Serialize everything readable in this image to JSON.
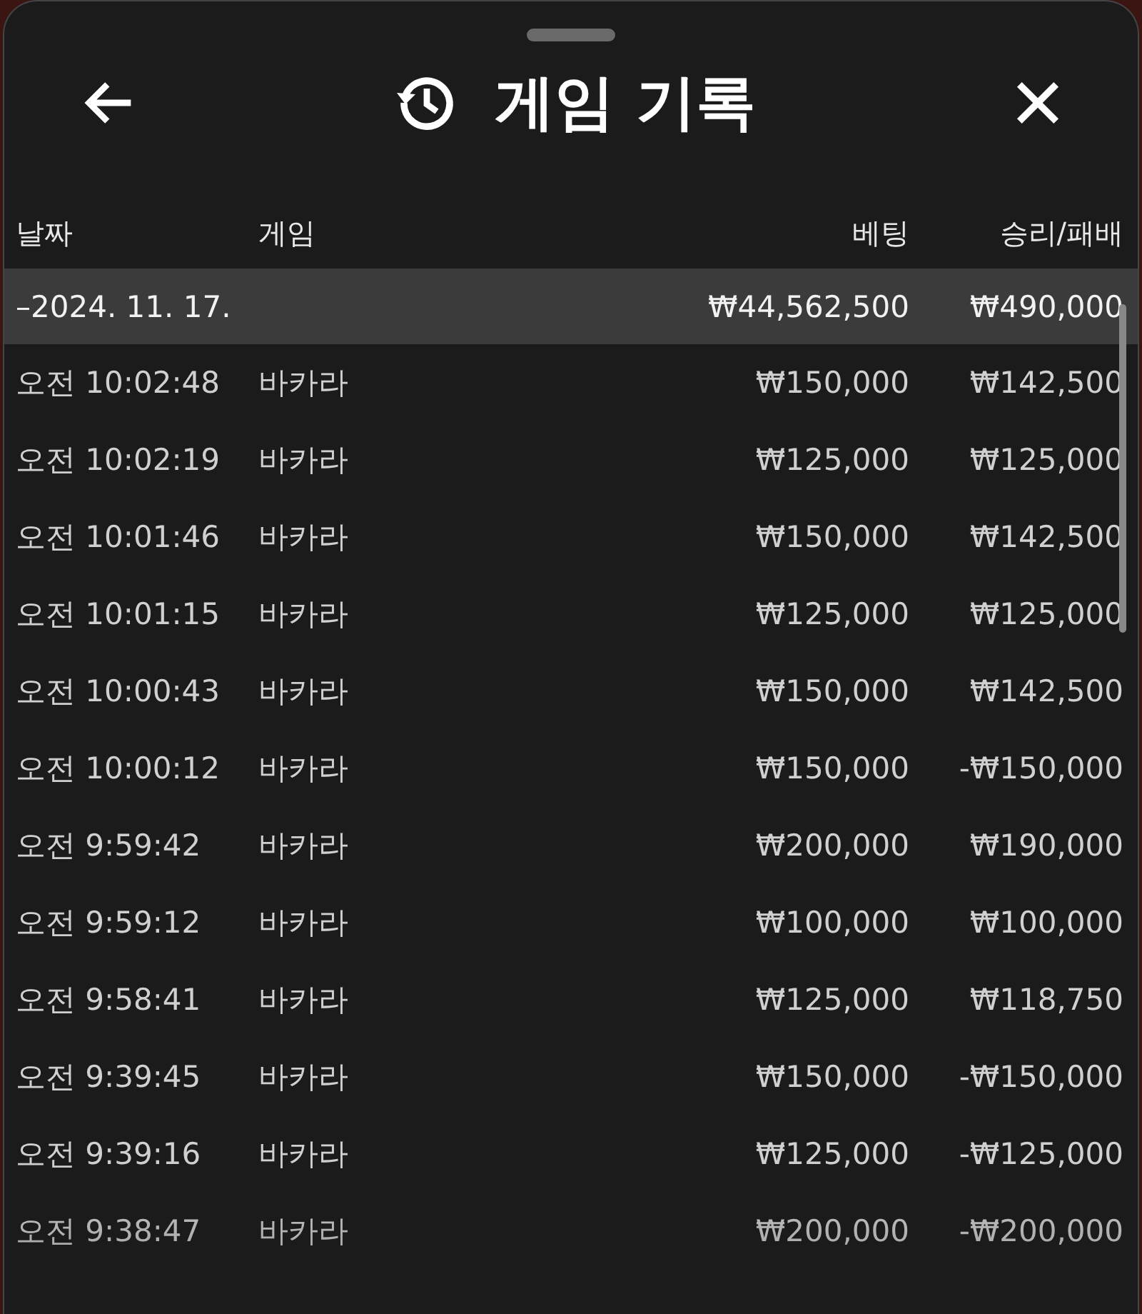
{
  "title": "게임 기록",
  "columns": [
    "날짜",
    "게임",
    "베팅",
    "승리/패배"
  ],
  "summary": {
    "date": "–2024. 11. 17.",
    "bet": "₩44,562,500",
    "result": "₩490,000"
  },
  "rows": [
    {
      "time": "오전 10:02:48",
      "game": "바카라",
      "bet": "₩150,000",
      "result": "₩142,500"
    },
    {
      "time": "오전 10:02:19",
      "game": "바카라",
      "bet": "₩125,000",
      "result": "₩125,000"
    },
    {
      "time": "오전 10:01:46",
      "game": "바카라",
      "bet": "₩150,000",
      "result": "₩142,500"
    },
    {
      "time": "오전 10:01:15",
      "game": "바카라",
      "bet": "₩125,000",
      "result": "₩125,000"
    },
    {
      "time": "오전 10:00:43",
      "game": "바카라",
      "bet": "₩150,000",
      "result": "₩142,500"
    },
    {
      "time": "오전 10:00:12",
      "game": "바카라",
      "bet": "₩150,000",
      "result": "-₩150,000"
    },
    {
      "time": "오전 9:59:42",
      "game": "바카라",
      "bet": "₩200,000",
      "result": "₩190,000"
    },
    {
      "time": "오전 9:59:12",
      "game": "바카라",
      "bet": "₩100,000",
      "result": "₩100,000"
    },
    {
      "time": "오전 9:58:41",
      "game": "바카라",
      "bet": "₩125,000",
      "result": "₩118,750"
    },
    {
      "time": "오전 9:39:45",
      "game": "바카라",
      "bet": "₩150,000",
      "result": "-₩150,000"
    },
    {
      "time": "오전 9:39:16",
      "game": "바카라",
      "bet": "₩125,000",
      "result": "-₩125,000"
    },
    {
      "time": "오전 9:38:47",
      "game": "바카라",
      "bet": "₩200,000",
      "result": "-₩200,000"
    }
  ]
}
